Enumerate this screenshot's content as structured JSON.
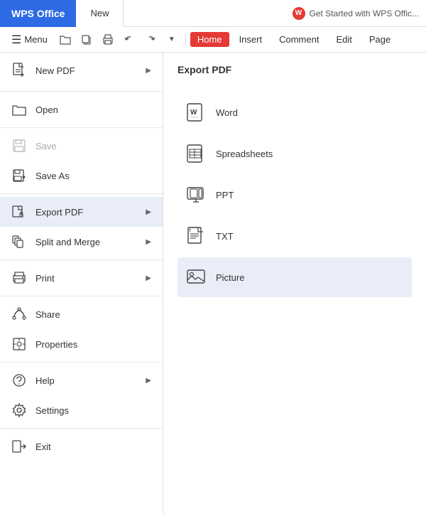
{
  "titlebar": {
    "wps_label": "WPS Office",
    "tab_label": "New",
    "right_text": "Get Started with WPS Offic..."
  },
  "toolbar": {
    "menu_label": "Menu",
    "home_label": "Home",
    "insert_label": "Insert",
    "comment_label": "Comment",
    "edit_label": "Edit",
    "page_label": "Page"
  },
  "left_menu": {
    "items": [
      {
        "id": "new-pdf",
        "label": "New PDF",
        "has_arrow": true,
        "disabled": false
      },
      {
        "id": "open",
        "label": "Open",
        "has_arrow": false,
        "disabled": false
      },
      {
        "id": "save",
        "label": "Save",
        "has_arrow": false,
        "disabled": true
      },
      {
        "id": "save-as",
        "label": "Save As",
        "has_arrow": false,
        "disabled": false
      },
      {
        "id": "export-pdf",
        "label": "Export PDF",
        "has_arrow": true,
        "disabled": false,
        "active": true
      },
      {
        "id": "split-merge",
        "label": "Split and Merge",
        "has_arrow": true,
        "disabled": false
      },
      {
        "id": "print",
        "label": "Print",
        "has_arrow": true,
        "disabled": false
      },
      {
        "id": "share",
        "label": "Share",
        "has_arrow": false,
        "disabled": false
      },
      {
        "id": "properties",
        "label": "Properties",
        "has_arrow": false,
        "disabled": false
      },
      {
        "id": "help",
        "label": "Help",
        "has_arrow": true,
        "disabled": false
      },
      {
        "id": "settings",
        "label": "Settings",
        "has_arrow": false,
        "disabled": false
      },
      {
        "id": "exit",
        "label": "Exit",
        "has_arrow": false,
        "disabled": false
      }
    ]
  },
  "right_panel": {
    "title": "Export PDF",
    "items": [
      {
        "id": "word",
        "label": "Word",
        "highlighted": false
      },
      {
        "id": "spreadsheets",
        "label": "Spreadsheets",
        "highlighted": false
      },
      {
        "id": "ppt",
        "label": "PPT",
        "highlighted": false
      },
      {
        "id": "txt",
        "label": "TXT",
        "highlighted": false
      },
      {
        "id": "picture",
        "label": "Picture",
        "highlighted": true
      }
    ]
  }
}
